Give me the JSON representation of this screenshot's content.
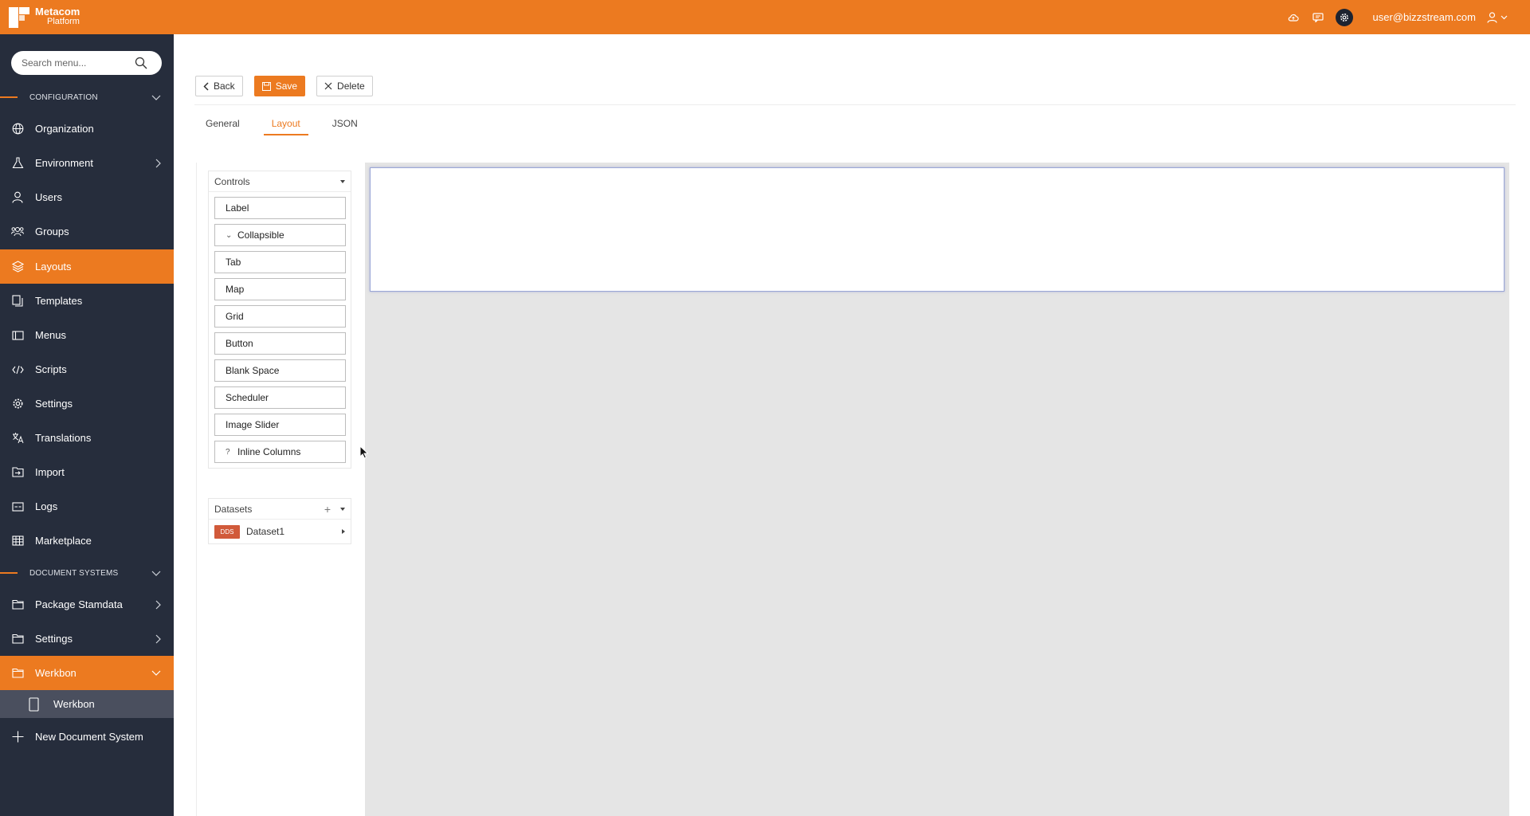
{
  "app": {
    "brand_line1": "Metacom",
    "brand_line2": "Platform",
    "user_email": "user@bizzstream.com"
  },
  "colors": {
    "accent": "#ec7a20",
    "sidebar_bg": "#262d3c",
    "canvas_bg": "#e5e5e5",
    "dataset_badge": "#d15a3a"
  },
  "icons": {
    "top": [
      "cloud-icon",
      "chat-icon",
      "gear-icon",
      "user-icon"
    ]
  },
  "sidebar": {
    "search_placeholder": "Search menu...",
    "sections": [
      {
        "title": "CONFIGURATION"
      },
      {
        "title": "DOCUMENT SYSTEMS"
      }
    ],
    "config_items": [
      {
        "label": "Organization",
        "icon": "globe-icon"
      },
      {
        "label": "Environment",
        "icon": "flask-icon",
        "has_children": true
      },
      {
        "label": "Users",
        "icon": "user-icon"
      },
      {
        "label": "Groups",
        "icon": "group-icon"
      },
      {
        "label": "Layouts",
        "icon": "layers-icon",
        "active": true
      },
      {
        "label": "Templates",
        "icon": "copy-icon"
      },
      {
        "label": "Menus",
        "icon": "menu-icon"
      },
      {
        "label": "Scripts",
        "icon": "code-icon"
      },
      {
        "label": "Settings",
        "icon": "gear-icon"
      },
      {
        "label": "Translations",
        "icon": "translate-icon"
      },
      {
        "label": "Import",
        "icon": "import-icon"
      },
      {
        "label": "Logs",
        "icon": "logs-icon"
      },
      {
        "label": "Marketplace",
        "icon": "grid-icon"
      }
    ],
    "doc_items": [
      {
        "label": "Package Stamdata",
        "icon": "folder-icon",
        "has_children": true
      },
      {
        "label": "Settings",
        "icon": "folder-icon",
        "has_children": true
      },
      {
        "label": "Werkbon",
        "icon": "folder-icon",
        "expanded": true,
        "active": true
      },
      {
        "label": "Werkbon",
        "icon": "tablet-icon",
        "sub": true
      },
      {
        "label": "New Document System",
        "icon": "plus-icon"
      }
    ]
  },
  "toolbar": {
    "back_label": "Back",
    "save_label": "Save",
    "delete_label": "Delete"
  },
  "tabs": [
    {
      "label": "General"
    },
    {
      "label": "Layout",
      "active": true
    },
    {
      "label": "JSON"
    }
  ],
  "controls_panel": {
    "title": "Controls",
    "items": [
      {
        "label": "Label",
        "prefix": ""
      },
      {
        "label": "Collapsible",
        "prefix": "⌄"
      },
      {
        "label": "Tab",
        "prefix": ""
      },
      {
        "label": "Map",
        "prefix": ""
      },
      {
        "label": "Grid",
        "prefix": ""
      },
      {
        "label": "Button",
        "prefix": ""
      },
      {
        "label": "Blank Space",
        "prefix": ""
      },
      {
        "label": "Scheduler",
        "prefix": ""
      },
      {
        "label": "Image Slider",
        "prefix": ""
      },
      {
        "label": "Inline Columns",
        "prefix": "?"
      }
    ]
  },
  "datasets_panel": {
    "title": "Datasets",
    "items": [
      {
        "badge": "DDS",
        "name": "Dataset1"
      }
    ]
  }
}
